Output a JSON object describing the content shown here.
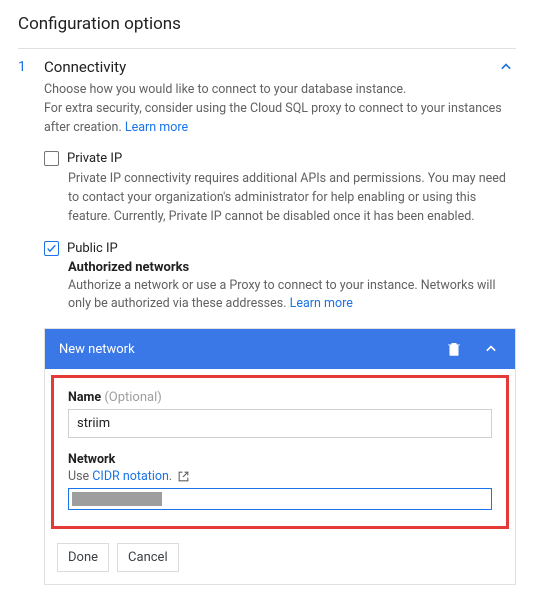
{
  "page": {
    "title": "Configuration options"
  },
  "section": {
    "step": "1",
    "title": "Connectivity",
    "desc_line1": "Choose how you would like to connect to your database instance.",
    "desc_line2_a": "For extra security, consider using the Cloud SQL proxy to connect to your instances after creation. ",
    "learn_more": "Learn more"
  },
  "private_ip": {
    "label": "Private IP",
    "desc": "Private IP connectivity requires additional APIs and permissions. You may need to contact your organization's administrator for help enabling or using this feature. Currently, Private IP cannot be disabled once it has been enabled."
  },
  "public_ip": {
    "label": "Public IP",
    "auth_heading": "Authorized networks",
    "auth_desc": "Authorize a network or use a Proxy to connect to your instance. Networks will only be authorized via these addresses. ",
    "learn_more": "Learn more"
  },
  "network_card": {
    "header": "New network",
    "name_label": "Name",
    "optional": " (Optional)",
    "name_value": "striim",
    "network_label": "Network",
    "network_help_a": "Use ",
    "network_help_link": "CIDR notation",
    "network_help_b": ".",
    "done": "Done",
    "cancel": "Cancel"
  }
}
